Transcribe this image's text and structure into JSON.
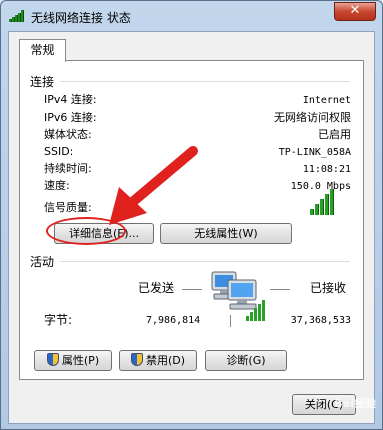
{
  "window": {
    "title": "无线网络连接 状态",
    "close_symbol": "✕"
  },
  "tab": {
    "label": "常规"
  },
  "connection": {
    "heading": "连接",
    "rows": [
      {
        "label": "IPv4 连接:",
        "value": "Internet"
      },
      {
        "label": "IPv6 连接:",
        "value": "无网络访问权限"
      },
      {
        "label": "媒体状态:",
        "value": "已启用"
      },
      {
        "label": "SSID:",
        "value": "TP-LINK_058A"
      },
      {
        "label": "持续时间:",
        "value": "11:08:21"
      },
      {
        "label": "速度:",
        "value": "150.0 Mbps"
      }
    ],
    "signal_label": "信号质量:",
    "signal_bars": 5,
    "signal_color": "#2aa02a"
  },
  "buttons": {
    "details": "详细信息(E)...",
    "wireless_props": "无线属性(W)",
    "properties": "属性(P)",
    "disable": "禁用(D)",
    "diagnose": "诊断(G)",
    "close": "关闭(C)"
  },
  "activity": {
    "heading": "活动",
    "sent_label": "已发送",
    "received_label": "已接收",
    "bytes_label": "字节:",
    "bytes_sent": "7,986,814",
    "bytes_received": "37,368,533"
  },
  "annotation": {
    "arrow_color": "#e0221e"
  },
  "watermark": "Bai经验"
}
